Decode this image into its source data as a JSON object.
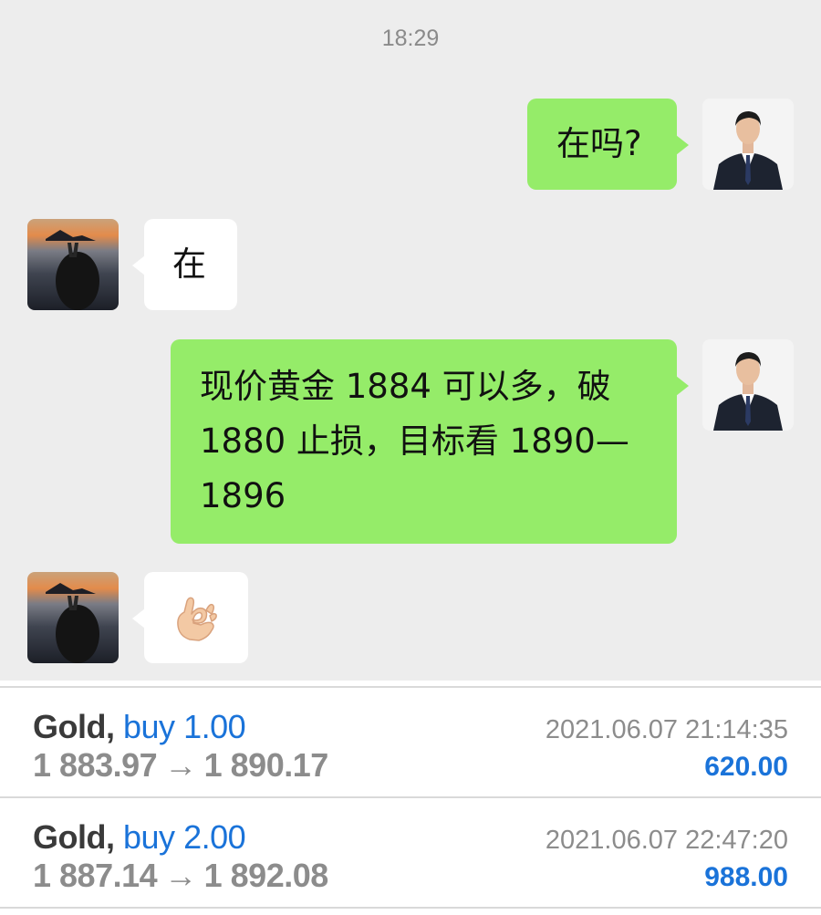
{
  "chat": {
    "timestamp": "18:29",
    "messages": [
      {
        "from": "me",
        "text": "在吗?"
      },
      {
        "from": "them",
        "text": "在"
      },
      {
        "from": "me",
        "lines": [
          "现价黄金 1884 可以多，破",
          "1880 止损，目标看 1890—",
          "1896"
        ]
      },
      {
        "from": "them",
        "emoji": "ok-hand-icon"
      }
    ]
  },
  "trades": [
    {
      "symbol": "Gold",
      "side": "buy",
      "volume": "1.00",
      "open_price": "1 883.97",
      "arrow": "→",
      "close_price": "1 890.17",
      "time": "2021.06.07 21:14:35",
      "profit": "620.00"
    },
    {
      "symbol": "Gold",
      "side": "buy",
      "volume": "2.00",
      "open_price": "1 887.14",
      "arrow": "→",
      "close_price": "1 892.08",
      "time": "2021.06.07 22:47:20",
      "profit": "988.00"
    }
  ],
  "colors": {
    "chat_bg": "#ededed",
    "my_bubble": "#95ec69",
    "their_bubble": "#ffffff",
    "accent_blue": "#1a73d9",
    "muted_gray": "#8c8c8c"
  }
}
